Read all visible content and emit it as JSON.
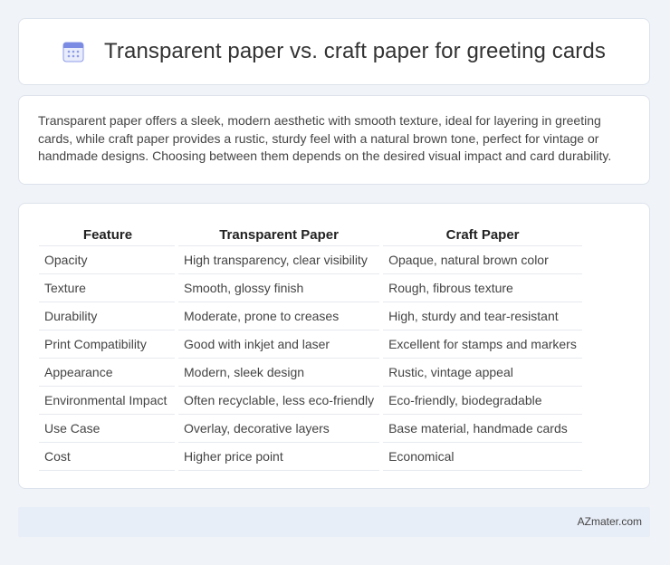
{
  "header": {
    "title": "Transparent paper vs. craft paper for greeting cards",
    "icon": "calendar-icon",
    "icon_color": "#6b7be0"
  },
  "intro": {
    "text": "Transparent paper offers a sleek, modern aesthetic with smooth texture, ideal for layering in greeting cards, while craft paper provides a rustic, sturdy feel with a natural brown tone, perfect for vintage or handmade designs. Choosing between them depends on the desired visual impact and card durability."
  },
  "table": {
    "headers": [
      "Feature",
      "Transparent Paper",
      "Craft Paper"
    ],
    "rows": [
      [
        "Opacity",
        "High transparency, clear visibility",
        "Opaque, natural brown color"
      ],
      [
        "Texture",
        "Smooth, glossy finish",
        "Rough, fibrous texture"
      ],
      [
        "Durability",
        "Moderate, prone to creases",
        "High, sturdy and tear-resistant"
      ],
      [
        "Print Compatibility",
        "Good with inkjet and laser",
        "Excellent for stamps and markers"
      ],
      [
        "Appearance",
        "Modern, sleek design",
        "Rustic, vintage appeal"
      ],
      [
        "Environmental Impact",
        "Often recyclable, less eco-friendly",
        "Eco-friendly, biodegradable"
      ],
      [
        "Use Case",
        "Overlay, decorative layers",
        "Base material, handmade cards"
      ],
      [
        "Cost",
        "Higher price point",
        "Economical"
      ]
    ]
  },
  "footer": {
    "brand": "AZmater.com"
  }
}
